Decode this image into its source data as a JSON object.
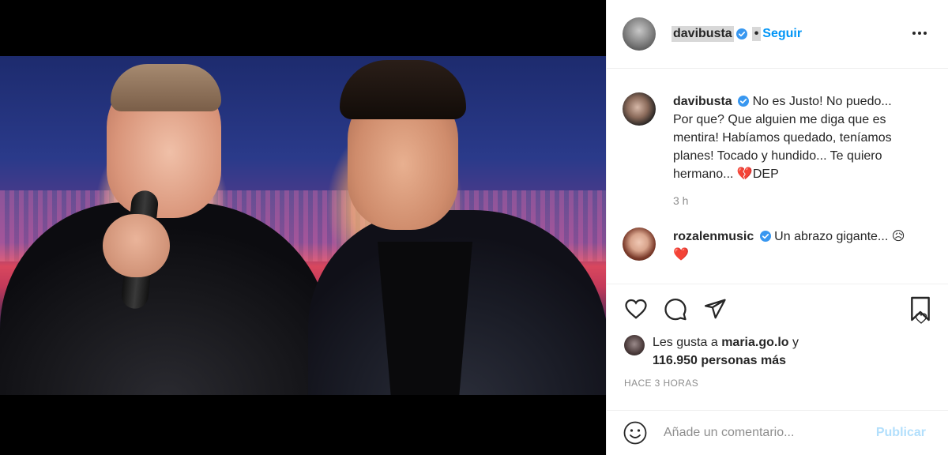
{
  "post": {
    "username": "davibusta",
    "separator": "•",
    "follow_label": "Seguir",
    "more_label": "More options"
  },
  "comments": [
    {
      "username": "davibusta",
      "text": "No es Justo! No puedo... Por que? Que alguien me diga que es mentira! Habíamos quedado, teníamos planes! Tocado y hundido... Te quiero hermano... 💔DEP",
      "time": "3 h"
    },
    {
      "username": "rozalenmusic",
      "text": "Un abrazo gigante... 😥❤️"
    }
  ],
  "likes": {
    "prefix": "Les gusta a",
    "first_user": "maria.go.lo",
    "conjunction": "y",
    "others": "116.950 personas más"
  },
  "time_ago": "HACE 3 HORAS",
  "add_comment": {
    "placeholder": "Añade un comentario...",
    "publish_label": "Publicar"
  },
  "icons": {
    "verified": "verified-badge-icon",
    "like": "heart-icon",
    "comment": "comment-bubble-icon",
    "share": "paper-plane-icon",
    "save": "bookmark-icon",
    "emoji": "emoji-smile-icon"
  },
  "colors": {
    "accent": "#0095f6",
    "muted": "#8e8e8e",
    "disabled_publish": "#b2dffc"
  }
}
